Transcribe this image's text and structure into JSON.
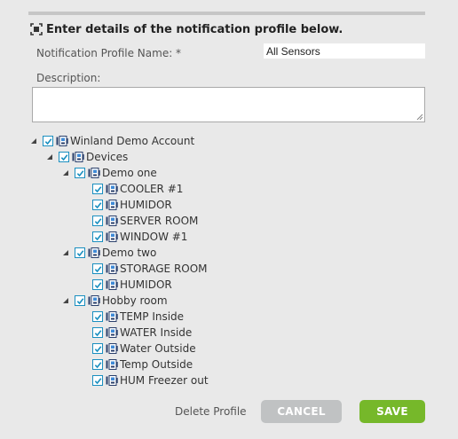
{
  "form": {
    "heading": "Enter details of the notification profile below.",
    "heading_icon": "target-icon",
    "name_label": "Notification Profile Name: *",
    "name_value": "All Sensors",
    "description_label": "Description:",
    "description_value": ""
  },
  "tree": {
    "root": {
      "label": "Winland Demo Account",
      "checked": true,
      "expanded": true
    },
    "devices": {
      "label": "Devices",
      "checked": true,
      "expanded": true
    },
    "groups": [
      {
        "label": "Demo one",
        "checked": true,
        "expanded": true,
        "items": [
          {
            "label": "COOLER #1",
            "checked": true
          },
          {
            "label": "HUMIDOR",
            "checked": true
          },
          {
            "label": "SERVER ROOM",
            "checked": true
          },
          {
            "label": "WINDOW #1",
            "checked": true
          }
        ]
      },
      {
        "label": "Demo two",
        "checked": true,
        "expanded": true,
        "items": [
          {
            "label": "STORAGE ROOM",
            "checked": true
          },
          {
            "label": "HUMIDOR",
            "checked": true
          }
        ]
      },
      {
        "label": "Hobby room",
        "checked": true,
        "expanded": true,
        "items": [
          {
            "label": "TEMP Inside",
            "checked": true
          },
          {
            "label": "WATER Inside",
            "checked": true
          },
          {
            "label": "Water Outside",
            "checked": true
          },
          {
            "label": "Temp Outside",
            "checked": true
          },
          {
            "label": "HUM Freezer out",
            "checked": true
          }
        ]
      }
    ]
  },
  "actions": {
    "delete_label": "Delete Profile",
    "cancel_label": "CANCEL",
    "save_label": "SAVE"
  },
  "colors": {
    "save": "#76b82a",
    "cancel": "#c0c2c3",
    "checkbox_border": "#1a8fc0",
    "background": "#e9e9e9"
  }
}
